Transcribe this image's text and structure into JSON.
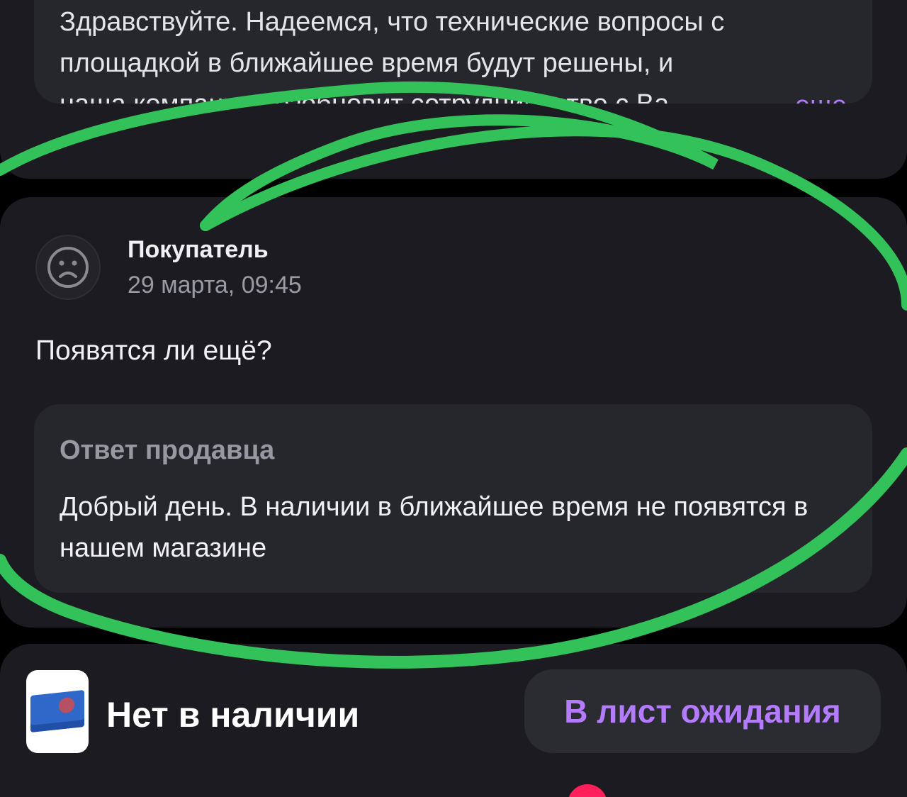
{
  "previous_review": {
    "answer_lines": [
      "Здравствуйте. Надеемся, что технические вопросы с",
      "площадкой в ближайшее время будут решены, и",
      "наша компания возобновит сотрудничество с Ва"
    ],
    "more_link": "еще"
  },
  "review": {
    "author": "Покупатель",
    "date": "29 марта, 09:45",
    "avatar_icon": "sad-face-icon",
    "question": "Появятся ли ещё?",
    "seller_answer": {
      "title": "Ответ продавца",
      "text": "Добрый день. В наличии в ближайшее время не появятся в нашем магазине"
    }
  },
  "bottom_bar": {
    "product_thumbnail": "product-box-image",
    "stock_status": "Нет в наличии",
    "waitlist_button": "В лист ожидания"
  },
  "colors": {
    "background": "#000000",
    "card": "#1b1b21",
    "inner_card": "#26262d",
    "accent": "#b57bff",
    "annotation": "#33c25a",
    "notification": "#ff1f5a"
  }
}
